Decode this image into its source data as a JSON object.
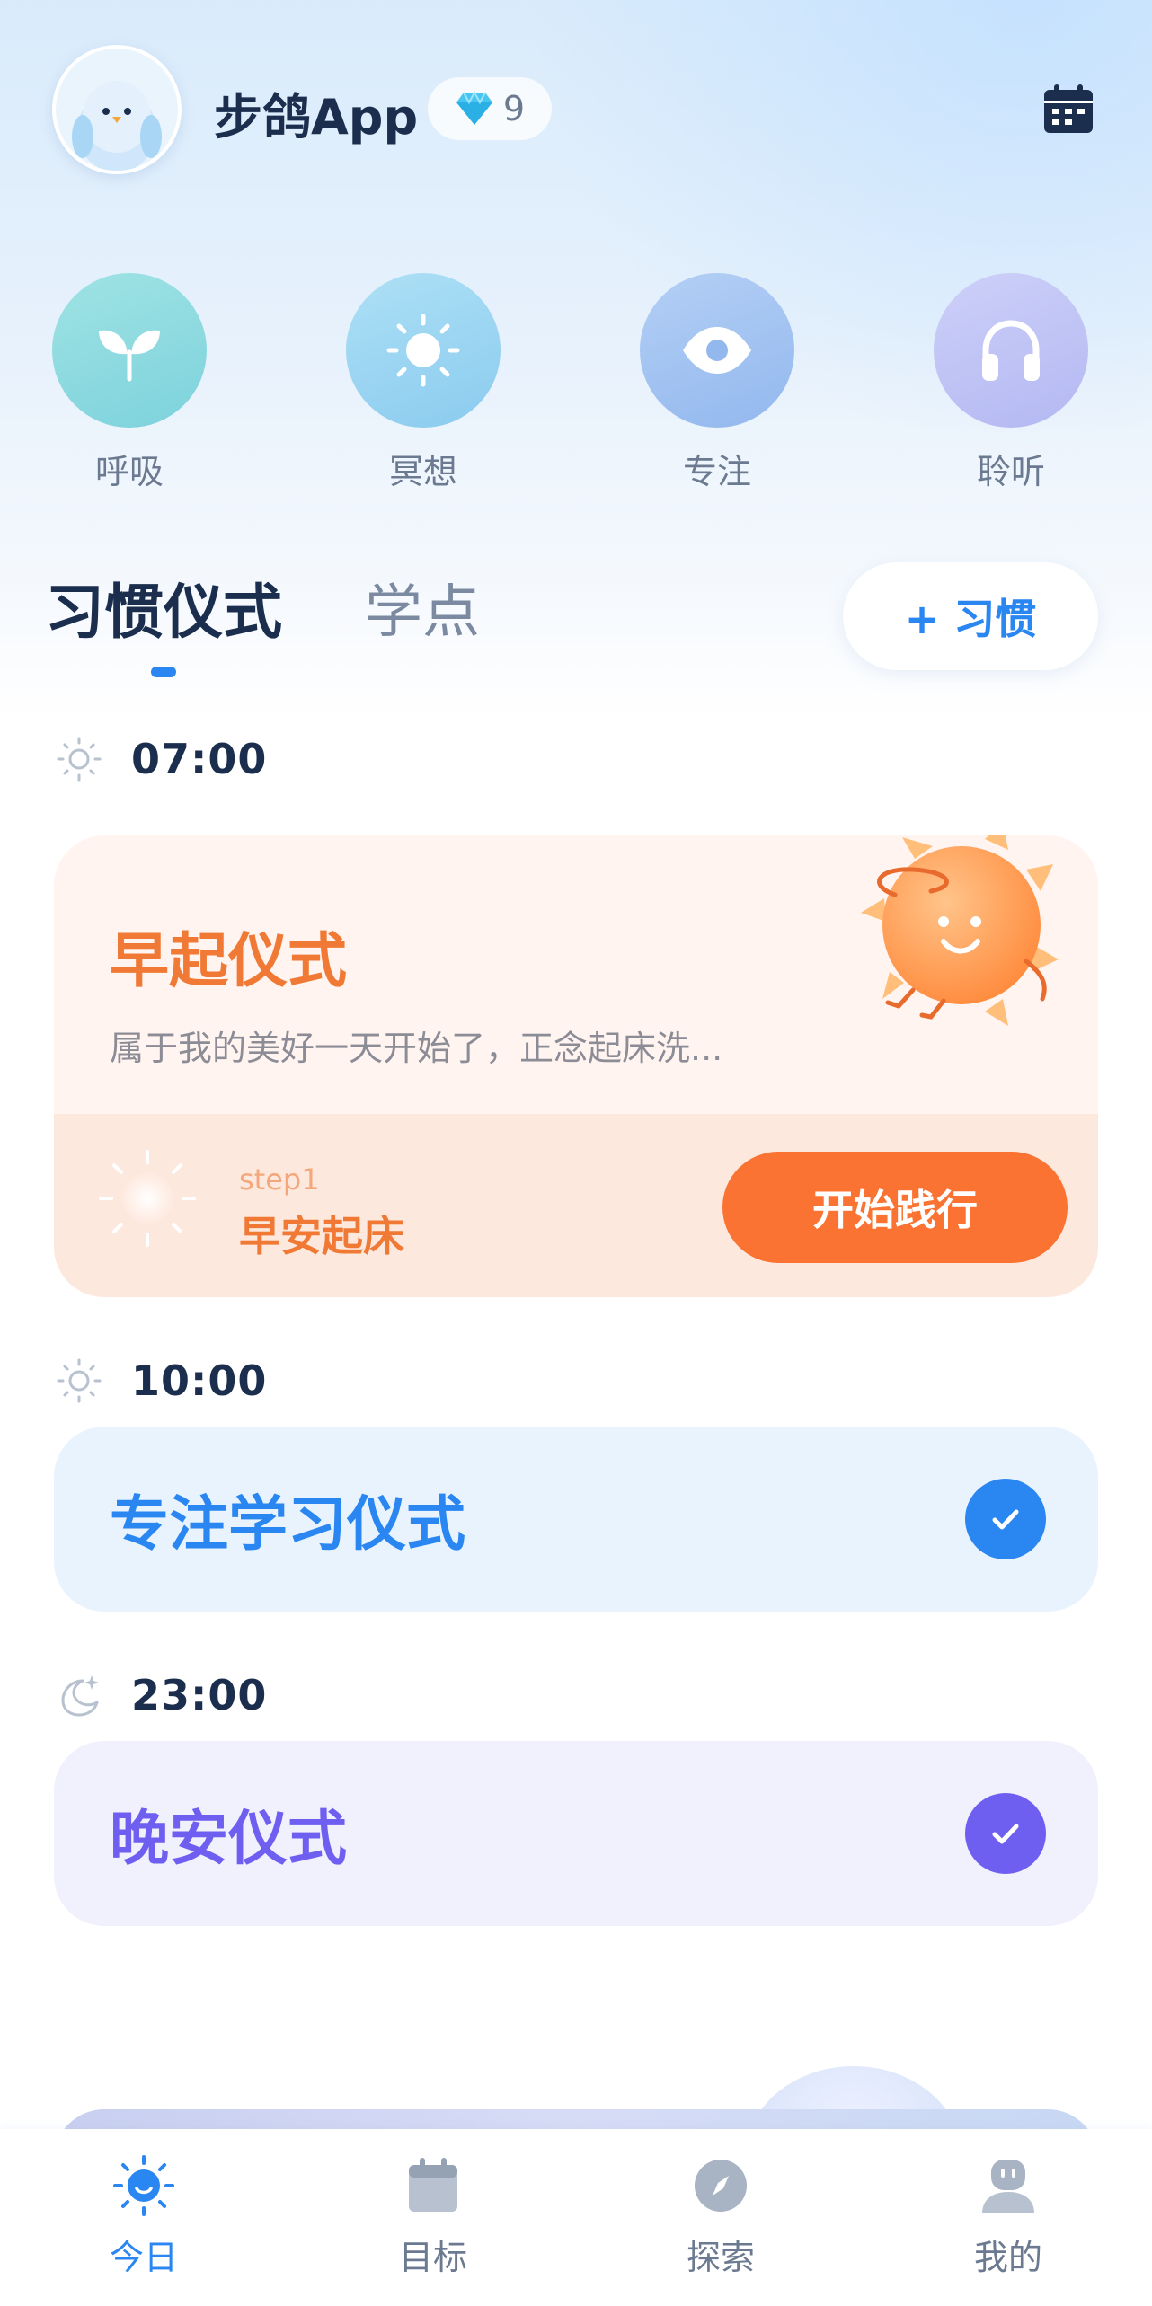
{
  "header": {
    "app_name": "步鸽App",
    "gem_count": "9",
    "avatar_icon": "bird-mascot-icon",
    "calendar_icon": "calendar-icon"
  },
  "tools": [
    {
      "label": "呼吸",
      "icon": "sprout-icon",
      "color": "#8fdcdf"
    },
    {
      "label": "冥想",
      "icon": "sun-icon",
      "color": "#9fd5f2"
    },
    {
      "label": "专注",
      "icon": "eye-icon",
      "color": "#a8c6f2"
    },
    {
      "label": "聆听",
      "icon": "headphones-icon",
      "color": "#c2c6f6"
    }
  ],
  "tabs": {
    "active": "习惯仪式",
    "inactive": "学点",
    "add_button": "+ 习惯"
  },
  "schedule": [
    {
      "time": "07:00",
      "time_icon": "sun-outline-icon",
      "title": "早起仪式",
      "description": "属于我的美好一天开始了，正念起床洗...",
      "step_label": "step1",
      "step_name": "早安起床",
      "action": "开始践行",
      "accent": "#fb7332"
    },
    {
      "time": "10:00",
      "time_icon": "sun-outline-icon",
      "title": "专注学习仪式",
      "completed": true,
      "accent": "#2a86f0"
    },
    {
      "time": "23:00",
      "time_icon": "moon-stars-icon",
      "title": "晚安仪式",
      "completed": true,
      "accent": "#6f5ff0"
    }
  ],
  "bottom_nav": [
    {
      "label": "今日",
      "icon": "sun-smile-icon",
      "active": true
    },
    {
      "label": "目标",
      "icon": "calendar-icon",
      "active": false
    },
    {
      "label": "探索",
      "icon": "compass-icon",
      "active": false
    },
    {
      "label": "我的",
      "icon": "profile-icon",
      "active": false
    }
  ]
}
